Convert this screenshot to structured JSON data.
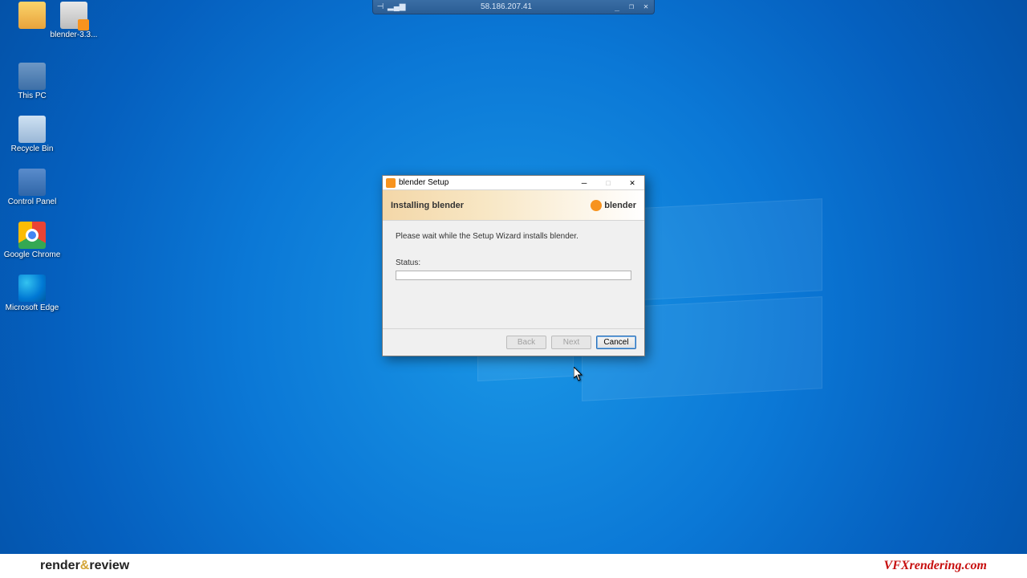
{
  "session": {
    "ip": "58.186.207.41"
  },
  "desktop_icons": [
    {
      "name": "folder",
      "label": ""
    },
    {
      "name": "blender-msi",
      "label": "blender-3.3..."
    },
    {
      "name": "this-pc",
      "label": "This PC"
    },
    {
      "name": "recycle-bin",
      "label": "Recycle Bin"
    },
    {
      "name": "control-panel",
      "label": "Control Panel"
    },
    {
      "name": "chrome",
      "label": "Google Chrome"
    },
    {
      "name": "edge",
      "label": "Microsoft Edge"
    }
  ],
  "dialog": {
    "window_title": "blender Setup",
    "header_title": "Installing blender",
    "brand": "blender",
    "message": "Please wait while the Setup Wizard installs blender.",
    "status_label": "Status:",
    "buttons": {
      "back": "Back",
      "next": "Next",
      "cancel": "Cancel"
    }
  },
  "watermark": {
    "left_a": "render",
    "left_amp": "&",
    "left_b": "review",
    "right": "VFXrendering.com"
  }
}
